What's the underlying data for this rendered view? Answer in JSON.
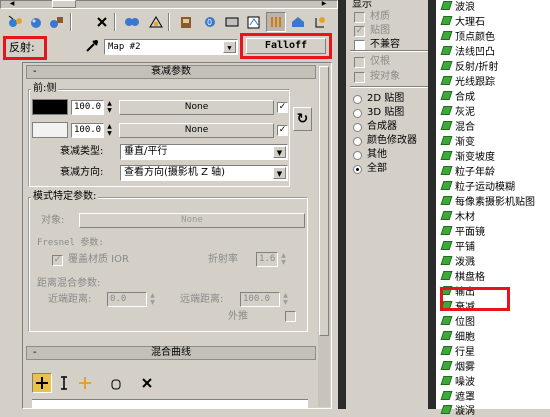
{
  "left": {
    "reflect_label": "反射:",
    "map_name": "Map #2",
    "map_type_button": "Falloff",
    "falloff_rollout_title": "衰减参数",
    "front_side_group": "前:侧",
    "rows": [
      {
        "value": "100.0",
        "map_button": "None",
        "checked": "✓"
      },
      {
        "value": "100.0",
        "map_button": "None",
        "checked": "✓"
      }
    ],
    "swap_icon": "↻",
    "falloff_type_label": "衰减类型:",
    "falloff_type_value": "垂直/平行",
    "falloff_dir_label": "衰减方向:",
    "falloff_dir_value": "查看方向(摄影机 Z 轴)",
    "mode_group": "模式特定参数:",
    "object_label": "对象:",
    "object_button": "None",
    "fresnel_label": "Fresnel 参数:",
    "override_ior_label": "覆盖材质 IOR",
    "override_ior_check": "✓",
    "ior_label": "折射率",
    "ior_value": "1.6",
    "distance_group": "距离混合参数:",
    "near_label": "近端距离:",
    "near_value": "0.0",
    "far_label": "远端距离:",
    "far_value": "100.0",
    "extrapolate_label": "外推",
    "mix_curve_title": "混合曲线"
  },
  "middle": {
    "show_label": "显示",
    "material_label": "材质",
    "map_label": "贴图",
    "map_check": "✓",
    "incompatible_label": "不兼容",
    "root_only_label": "仅根",
    "by_object_label": "按对象",
    "radios": [
      "2D 贴图",
      "3D 贴图",
      "合成器",
      "颜色修改器",
      "其他",
      "全部"
    ]
  },
  "right": {
    "items": [
      "波浪",
      "大理石",
      "顶点颜色",
      "法线凹凸",
      "反射/折射",
      "光线跟踪",
      "合成",
      "灰泥",
      "混合",
      "渐变",
      "渐变坡度",
      "粒子年龄",
      "粒子运动模糊",
      "每像素摄影机贴图",
      "木材",
      "平面镜",
      "平铺",
      "泼溅",
      "棋盘格",
      "输出",
      "衰减",
      "位图",
      "细胞",
      "行星",
      "烟雾",
      "噪波",
      "遮罩",
      "漩涡"
    ]
  },
  "colors": {
    "highlight": "#e8141b",
    "map_icon": "#3fa83b",
    "panel": "#d4d0c8"
  }
}
